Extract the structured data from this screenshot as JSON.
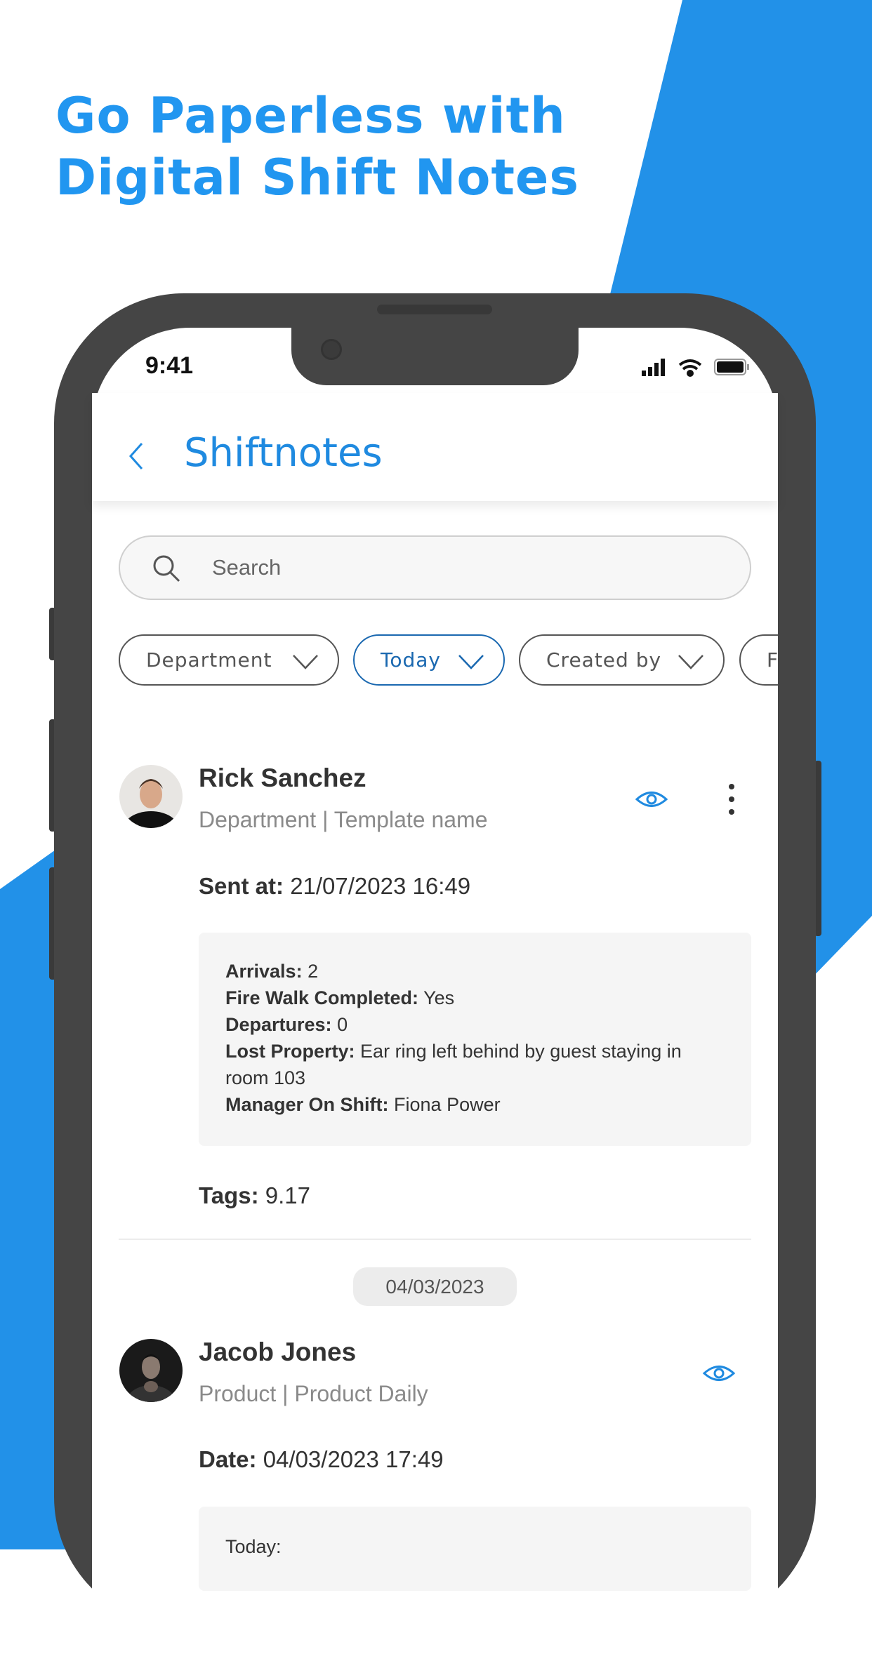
{
  "colors": {
    "accent": "#2291e8",
    "frame": "#454545",
    "text": "#333333",
    "muted": "#8a8a8a"
  },
  "headline": {
    "line1": "Go Paperless with",
    "line2": "Digital Shift Notes"
  },
  "status_bar": {
    "time": "9:41",
    "icons": [
      "signal-icon",
      "wifi-icon",
      "battery-icon"
    ]
  },
  "header": {
    "back_icon": "chevron-left-icon",
    "title": "Shiftnotes"
  },
  "search": {
    "placeholder": "Search",
    "icon": "search-icon"
  },
  "filters": [
    {
      "label": "Department",
      "active": false
    },
    {
      "label": "Today",
      "active": true
    },
    {
      "label": "Created by",
      "active": false
    },
    {
      "label": "F",
      "active": false
    }
  ],
  "notes": [
    {
      "name": "Rick Sanchez",
      "subtitle": "Department | Template name",
      "time_label": "Sent at:",
      "time_value": "21/07/2023 16:49",
      "fields": [
        {
          "k": "Arrivals:",
          "v": "2"
        },
        {
          "k": "Fire Walk Completed:",
          "v": "Yes"
        },
        {
          "k": "Departures:",
          "v": "0"
        },
        {
          "k": "Lost Property:",
          "v": "Ear ring left behind by guest staying in room 103"
        },
        {
          "k": "Manager On Shift:",
          "v": "Fiona Power"
        }
      ],
      "tags_label": "Tags:",
      "tags_value": "9.17"
    },
    {
      "date_separator": "04/03/2023",
      "name": "Jacob Jones",
      "subtitle": "Product | Product Daily",
      "time_label": "Date:",
      "time_value": "04/03/2023 17:49",
      "note_start": "Today:"
    }
  ]
}
